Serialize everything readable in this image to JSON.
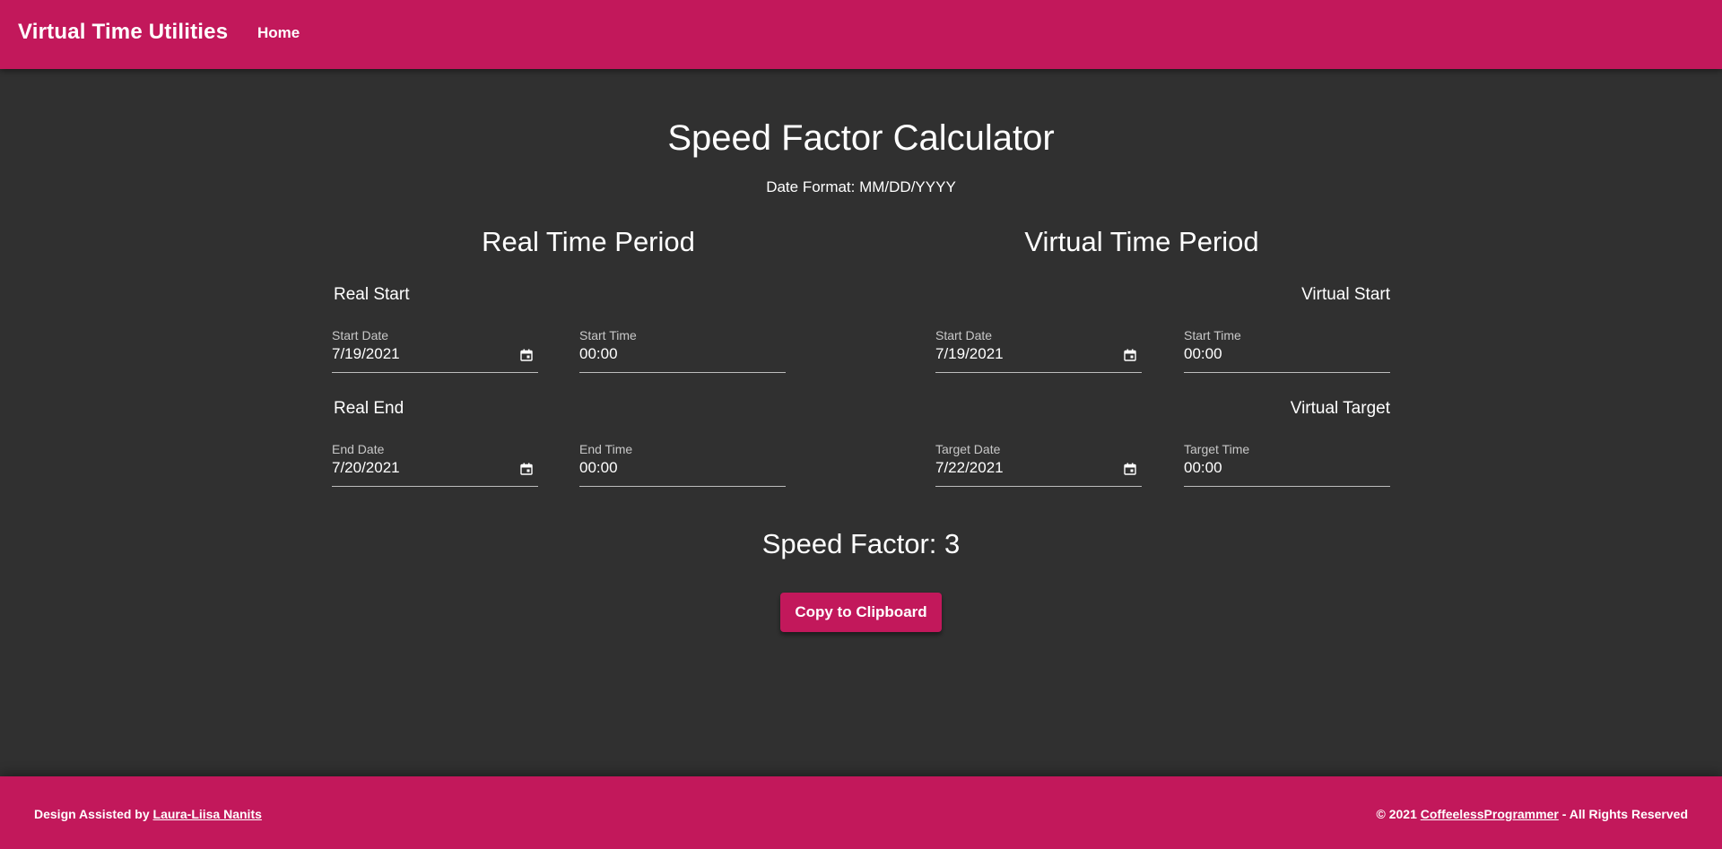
{
  "colors": {
    "primary": "#c2185b",
    "background": "#303030",
    "text": "#ffffff",
    "muted_label": "#c8c8c8"
  },
  "header": {
    "brand": "Virtual Time Utilities",
    "nav_home": "Home"
  },
  "main": {
    "title": "Speed Factor Calculator",
    "date_format": "Date Format: MM/DD/YYYY",
    "real": {
      "heading": "Real Time Period",
      "start": {
        "title": "Real Start",
        "date_label": "Start Date",
        "date_value": "7/19/2021",
        "time_label": "Start Time",
        "time_value": "00:00"
      },
      "end": {
        "title": "Real End",
        "date_label": "End Date",
        "date_value": "7/20/2021",
        "time_label": "End Time",
        "time_value": "00:00"
      }
    },
    "virtual": {
      "heading": "Virtual Time Period",
      "start": {
        "title": "Virtual Start",
        "date_label": "Start Date",
        "date_value": "7/19/2021",
        "time_label": "Start Time",
        "time_value": "00:00"
      },
      "target": {
        "title": "Virtual Target",
        "date_label": "Target Date",
        "date_value": "7/22/2021",
        "time_label": "Target Time",
        "time_value": "00:00"
      }
    },
    "speed_factor": "Speed Factor: 3",
    "copy_button": "Copy to Clipboard"
  },
  "footer": {
    "left_prefix": "Design Assisted by ",
    "left_link": "Laura-Liisa Nanits",
    "right_prefix": "© 2021 ",
    "right_link": "CoffeelessProgrammer",
    "right_suffix": " - All Rights Reserved"
  },
  "icons": {
    "calendar": "calendar-icon"
  }
}
